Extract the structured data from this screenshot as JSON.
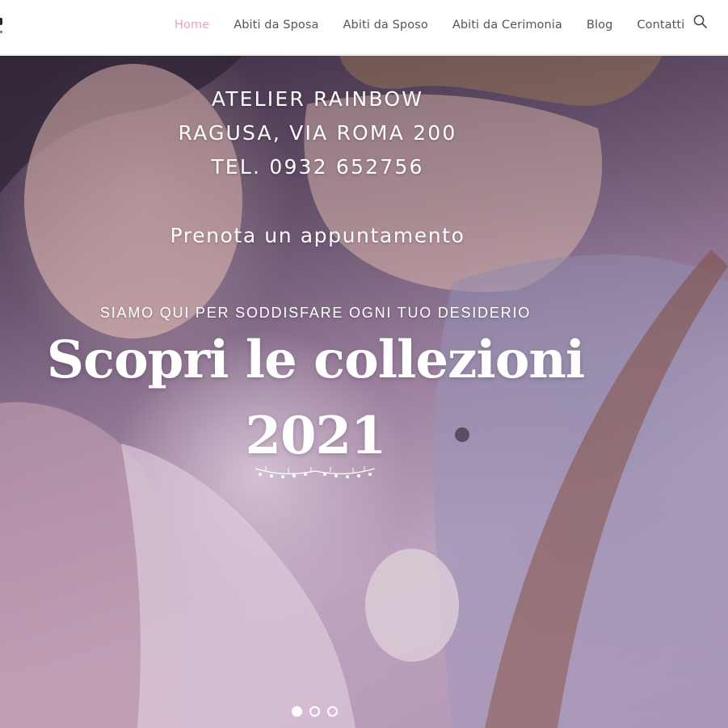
{
  "nav": {
    "items": [
      {
        "label": "Home",
        "active": true
      },
      {
        "label": "Abiti da Sposa",
        "active": false
      },
      {
        "label": "Abiti da Sposo",
        "active": false
      },
      {
        "label": "Abiti da Cerimonia",
        "active": false
      },
      {
        "label": "Blog",
        "active": false
      },
      {
        "label": "Contatti",
        "active": false
      }
    ],
    "search_icon": "search-icon"
  },
  "hero": {
    "contact_lines": [
      "ATELIER RAINBOW",
      "RAGUSA, VIA ROMA 200",
      "TEL. 0932 652756"
    ],
    "booking_link": "Prenota un appuntamento",
    "tagline": "SIAMO QUI PER SODDISFARE OGNI TUO DESIDERIO",
    "headline_line1": "Scopri le collezioni",
    "headline_line2": "2021",
    "divider_icon": "floral-divider-icon",
    "slider": {
      "total": 3,
      "current": 1
    }
  },
  "colors": {
    "nav_active": "#e6a7b5",
    "nav_text": "#555555",
    "hero_text": "#ffffff"
  }
}
